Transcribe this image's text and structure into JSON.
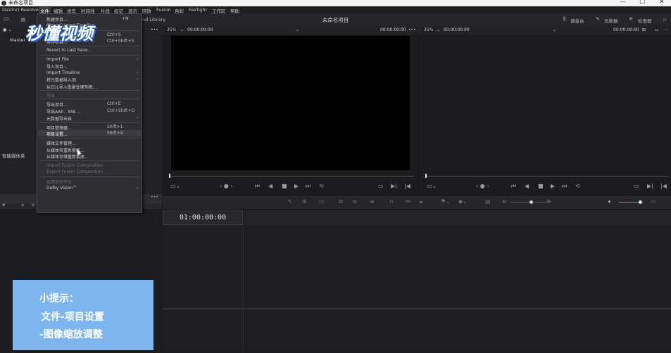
{
  "window": {
    "title": "未命名项目",
    "minimize_glyph": "—",
    "maximize_glyph": "☐",
    "close_glyph": "✕"
  },
  "menubar": {
    "items": [
      "DaVinci Resolve",
      "文件",
      "编辑",
      "修剪",
      "时间线",
      "片段",
      "标记",
      "显示",
      "回放",
      "Fusion",
      "色彩",
      "Fairlight",
      "工作区",
      "帮助"
    ]
  },
  "toolbar": {
    "project_title": "未命名项目",
    "media_storage_partial": "nd Library",
    "mixer_label": "调音台",
    "metadata_label": "元数据",
    "inspector_label": "检查器"
  },
  "viewers": {
    "source_zoom": "35%",
    "source_tc_left": "00:00:00:00",
    "source_tc_right": "00:00:00:00",
    "program_zoom": "35%",
    "program_tc_left": "00:00:00:00",
    "program_tc_right": "00:00:00:00"
  },
  "media_pool": {
    "master_label": "Master",
    "smart_bins_label": "智能媒体夹"
  },
  "timeline": {
    "timecode": "01:00:00:00"
  },
  "file_menu": {
    "items": [
      {
        "label": "新建项目...",
        "shortcut": "",
        "disabled": false
      },
      {
        "label": "Close Current Timeline",
        "shortcut": "",
        "disabled": false
      },
      {
        "label": "保存项目",
        "shortcut": "Ctrl+S",
        "disabled": false
      },
      {
        "label": "另存项目...",
        "shortcut": "Ctrl+Shift+S",
        "disabled": false
      },
      {
        "label": "Revert to Last Save...",
        "shortcut": "",
        "disabled": false
      },
      {
        "label": "Import File",
        "shortcut": "",
        "disabled": false,
        "submenu": true
      },
      {
        "label": "导入项目...",
        "shortcut": "",
        "disabled": false
      },
      {
        "label": "Import Timeline",
        "shortcut": "",
        "disabled": false,
        "submenu": true
      },
      {
        "label": "将元数据导入到",
        "shortcut": "",
        "disabled": false,
        "submenu": true
      },
      {
        "label": "从EDL导入批量处理列表...",
        "shortcut": "",
        "disabled": false
      },
      {
        "label": "导出",
        "shortcut": "",
        "disabled": true
      },
      {
        "label": "导出项目...",
        "shortcut": "Ctrl+E",
        "disabled": false
      },
      {
        "label": "导出AAF、XML...",
        "shortcut": "Ctrl+Shift+O",
        "disabled": false
      },
      {
        "label": "元数据导出自",
        "shortcut": "",
        "disabled": false,
        "submenu": true
      },
      {
        "label": "项目管理器...",
        "shortcut": "Shift+1",
        "disabled": false
      },
      {
        "label": "项目设置...",
        "shortcut": "Shift+9",
        "disabled": false,
        "highlighted": true
      },
      {
        "label": "媒体文件管理...",
        "shortcut": "",
        "disabled": false
      },
      {
        "label": "从媒体夹重新套底...",
        "shortcut": "",
        "disabled": false
      },
      {
        "label": "从媒体存储重新套底...",
        "shortcut": "",
        "disabled": false
      },
      {
        "label": "Import Fusion Composition...",
        "shortcut": "",
        "disabled": true
      },
      {
        "label": "Export Fusion Composition...",
        "shortcut": "",
        "disabled": true
      },
      {
        "label": "启用协作平台",
        "shortcut": "",
        "disabled": true
      },
      {
        "label": "Dolby Vision™",
        "shortcut": "",
        "disabled": false,
        "submenu": true
      }
    ],
    "new_project_shortcut_partial": "+N",
    "submenu_arrow": "›"
  },
  "watermark": {
    "text": "秒懂视频"
  },
  "tip": {
    "line1": "小提示：",
    "line2": "文件-项目设置",
    "line3": "-图像缩放调整"
  },
  "colors": {
    "menu_bg": "#2e2e33",
    "tip_bg": "#7db6ef",
    "viewer_black": "#000000"
  }
}
